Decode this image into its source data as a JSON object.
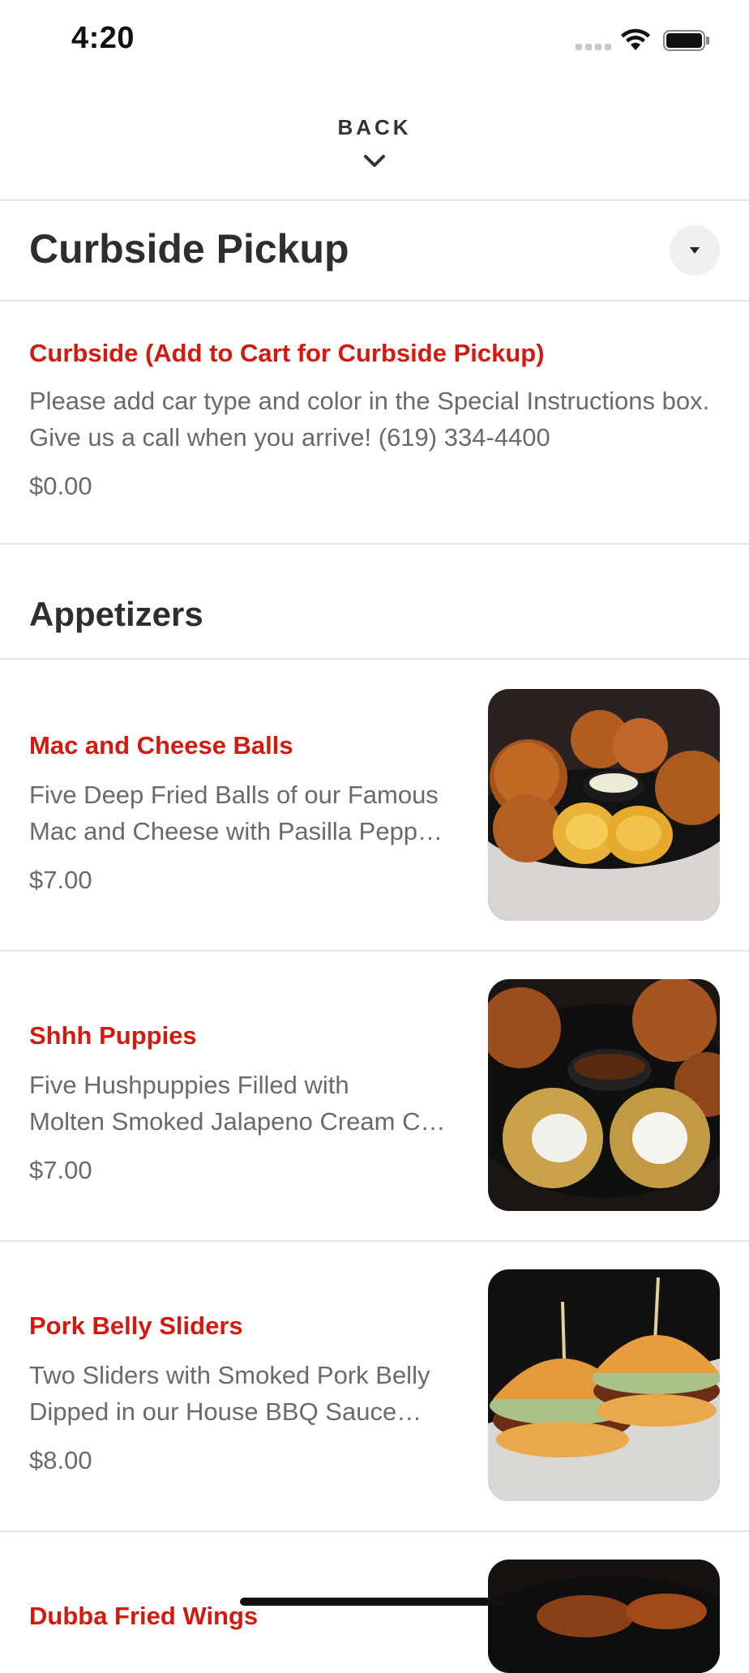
{
  "status_bar": {
    "time": "4:20"
  },
  "nav": {
    "back_label": "BACK"
  },
  "section": {
    "title": "Curbside Pickup"
  },
  "curbside": {
    "name": "Curbside (Add to Cart for Curbside Pickup)",
    "description": "Please add car type and color in the Special Instructions box. Give us a call when you arrive! (619) 334-4400",
    "price": "$0.00"
  },
  "category": {
    "title": "Appetizers"
  },
  "items": [
    {
      "name": "Mac and Cheese Balls",
      "desc_line1": "Five Deep Fried Balls of our Famous",
      "desc_line2": "Mac and Cheese with Pasilla Pepp…",
      "price": "$7.00",
      "photo": "mac-and-cheese-balls-photo"
    },
    {
      "name": "Shhh Puppies",
      "desc_line1": "Five Hushpuppies Filled with",
      "desc_line2": "Molten Smoked Jalapeno Cream C…",
      "price": "$7.00",
      "photo": "hushpuppies-photo"
    },
    {
      "name": "Pork Belly Sliders",
      "desc_line1": "Two Sliders with Smoked Pork Belly",
      "desc_line2": "Dipped in our House BBQ Sauce…",
      "price": "$8.00",
      "photo": "pork-belly-sliders-photo"
    },
    {
      "name": "Dubba Fried Wings",
      "photo": "fried-wings-photo"
    }
  ],
  "colors": {
    "accent": "#d4190f",
    "text": "#333333",
    "muted": "#6a6a6a",
    "divider": "#e6e6e6"
  }
}
